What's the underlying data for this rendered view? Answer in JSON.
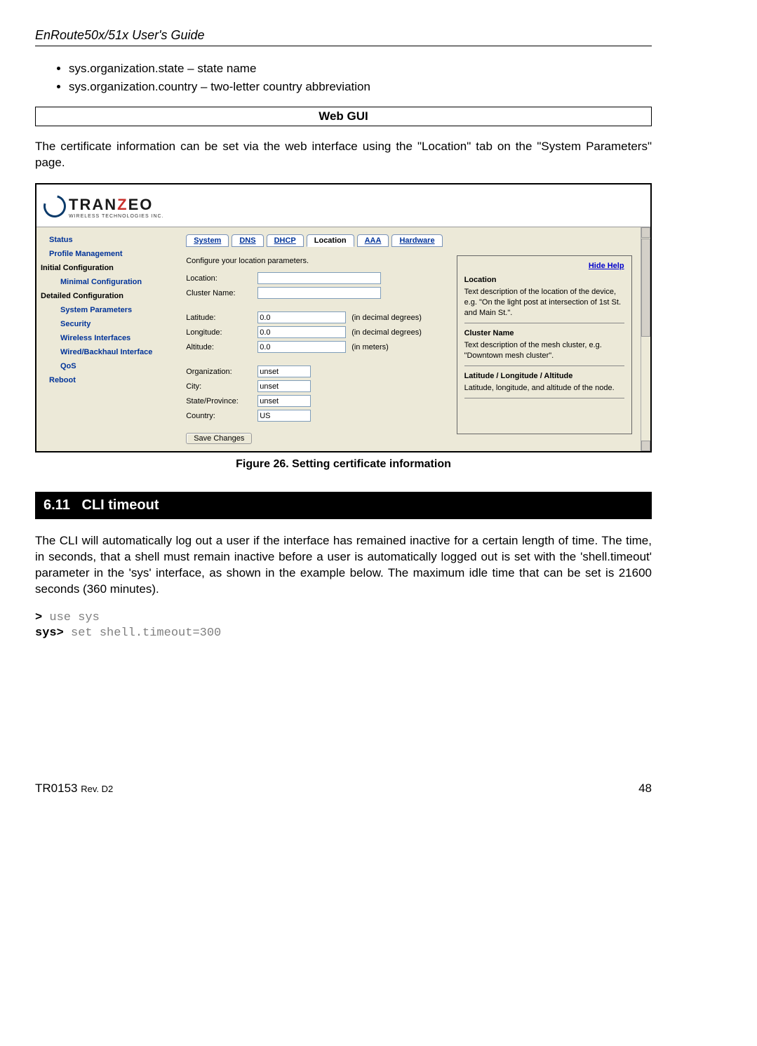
{
  "header": {
    "title": "EnRoute50x/51x User's Guide"
  },
  "bullets": [
    "sys.organization.state – state name",
    "sys.organization.country – two-letter country abbreviation"
  ],
  "webgui_label": "Web GUI",
  "intro_para": "The certificate information can be set via the web interface using the \"Location\" tab on the \"System Parameters\" page.",
  "logo": {
    "text_pre": "TRAN",
    "text_z": "Z",
    "text_post": "EO",
    "sub": "WIRELESS  TECHNOLOGIES INC."
  },
  "sidebar": {
    "items": [
      {
        "label": "Status",
        "cls": "item"
      },
      {
        "label": "Profile Management",
        "cls": "item"
      },
      {
        "label": "Initial Configuration",
        "cls": "heading"
      },
      {
        "label": "Minimal Configuration",
        "cls": "item sub"
      },
      {
        "label": "Detailed Configuration",
        "cls": "heading"
      },
      {
        "label": "System Parameters",
        "cls": "item sub"
      },
      {
        "label": "Security",
        "cls": "item sub"
      },
      {
        "label": "Wireless Interfaces",
        "cls": "item sub"
      },
      {
        "label": "Wired/Backhaul Interface",
        "cls": "item sub"
      },
      {
        "label": "QoS",
        "cls": "item sub"
      },
      {
        "label": "Reboot",
        "cls": "item"
      }
    ]
  },
  "tabs": [
    "System",
    "DNS",
    "DHCP",
    "Location",
    "AAA",
    "Hardware"
  ],
  "active_tab": "Location",
  "form": {
    "intro": "Configure your location parameters.",
    "location_lbl": "Location:",
    "cluster_lbl": "Cluster Name:",
    "latitude_lbl": "Latitude:",
    "longitude_lbl": "Longitude:",
    "altitude_lbl": "Altitude:",
    "latitude_val": "0.0",
    "longitude_val": "0.0",
    "altitude_val": "0.0",
    "deg_hint": "(in decimal degrees)",
    "meters_hint": "(in meters)",
    "org_lbl": "Organization:",
    "org_val": "unset",
    "city_lbl": "City:",
    "city_val": "unset",
    "state_lbl": "State/Province:",
    "state_val": "unset",
    "country_lbl": "Country:",
    "country_val": "US",
    "save_btn": "Save Changes"
  },
  "help": {
    "hide": "Hide Help",
    "h1": "Location",
    "p1": "Text description of the location of the device, e.g. \"On the light post at intersection of 1st St. and Main St.\".",
    "h2": "Cluster Name",
    "p2": "Text description of the mesh cluster, e.g. \"Downtown mesh cluster\".",
    "h3": "Latitude / Longitude / Altitude",
    "p3": "Latitude, longitude, and altitude of the node."
  },
  "figure_caption": "Figure 26. Setting certificate information",
  "section": {
    "num": "6.11",
    "title": "CLI timeout"
  },
  "cli_para": "The CLI will automatically log out a user if the interface has remained inactive for a certain length of time. The time, in seconds, that a shell must remain inactive before a user is automatically logged out is set with the 'shell.timeout' parameter in the 'sys' interface, as shown in the example below. The maximum idle time that can be set is 21600 seconds (360 minutes).",
  "code": {
    "p1": ">",
    "c1": " use sys",
    "p2": "sys>",
    "c2": " set shell.timeout=300"
  },
  "footer": {
    "left_main": "TR0153 ",
    "left_rev": "Rev. D2",
    "page": "48"
  }
}
